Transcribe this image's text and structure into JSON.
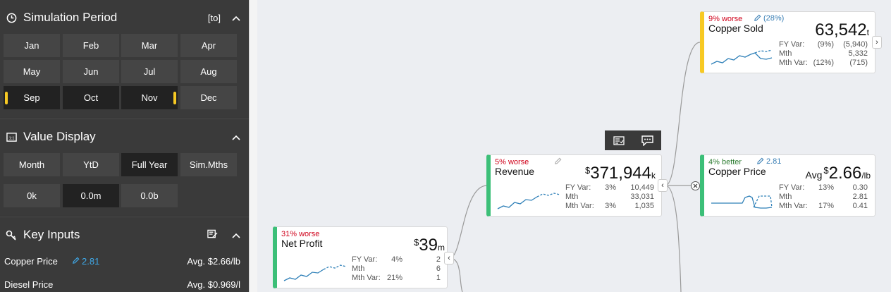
{
  "simulation_period": {
    "title": "Simulation Period",
    "range_label": "[to]",
    "months": [
      "Jan",
      "Feb",
      "Mar",
      "Apr",
      "May",
      "Jun",
      "Jul",
      "Aug",
      "Sep",
      "Oct",
      "Nov",
      "Dec"
    ]
  },
  "value_display": {
    "title": "Value Display",
    "modes": [
      "Month",
      "YtD",
      "Full Year",
      "Sim.Mths"
    ],
    "scales": [
      "0k",
      "0.0m",
      "0.0b"
    ]
  },
  "key_inputs": {
    "title": "Key Inputs",
    "rows": [
      {
        "label": "Copper Price",
        "edit": "2.81",
        "value": "Avg. $2.66/lb"
      },
      {
        "label": "Diesel Price",
        "edit": "",
        "value": "Avg. $0.969/l"
      }
    ]
  },
  "nodes": {
    "net_profit": {
      "status": "31% worse",
      "name": "Net Profit",
      "prefix": "$",
      "value": "39",
      "unit": "m",
      "rows": [
        {
          "label": "FY Var:",
          "pct": "4%",
          "val": "2"
        },
        {
          "label": "Mth",
          "pct": "",
          "val": "6"
        },
        {
          "label": "Mth Var:",
          "pct": "21%",
          "val": "1"
        }
      ]
    },
    "revenue": {
      "status": "5% worse",
      "name": "Revenue",
      "prefix": "$",
      "value": "371,944",
      "unit": "k",
      "rows": [
        {
          "label": "FY Var:",
          "pct": "3%",
          "val": "10,449"
        },
        {
          "label": "Mth",
          "pct": "",
          "val": "33,031"
        },
        {
          "label": "Mth Var:",
          "pct": "3%",
          "val": "1,035"
        }
      ]
    },
    "copper_sold": {
      "status": "9% worse",
      "edit": "(28%)",
      "name": "Copper Sold",
      "value": "63,542",
      "unit": "t",
      "rows": [
        {
          "label": "FY Var:",
          "pct": "(9%)",
          "val": "(5,940)"
        },
        {
          "label": "Mth",
          "pct": "",
          "val": "5,332"
        },
        {
          "label": "Mth Var:",
          "pct": "(12%)",
          "val": "(715)"
        }
      ]
    },
    "copper_price": {
      "status": "4% better",
      "edit": "2.81",
      "name": "Copper Price",
      "pre_label": "Avg",
      "prefix": "$",
      "value": "2.66",
      "unit": "/lb",
      "rows": [
        {
          "label": "FY Var:",
          "pct": "13%",
          "val": "0.30"
        },
        {
          "label": "Mth",
          "pct": "",
          "val": "2.81"
        },
        {
          "label": "Mth Var:",
          "pct": "17%",
          "val": "0.41"
        }
      ]
    }
  },
  "colors": {
    "sidebar_bg": "#3a3a3a",
    "selected_marker": "#f7c923",
    "good": "#2e7d32",
    "bad": "#d0021b",
    "node_green": "#3cbf78",
    "node_yellow": "#f7c923",
    "spark": "#2f80b8"
  }
}
